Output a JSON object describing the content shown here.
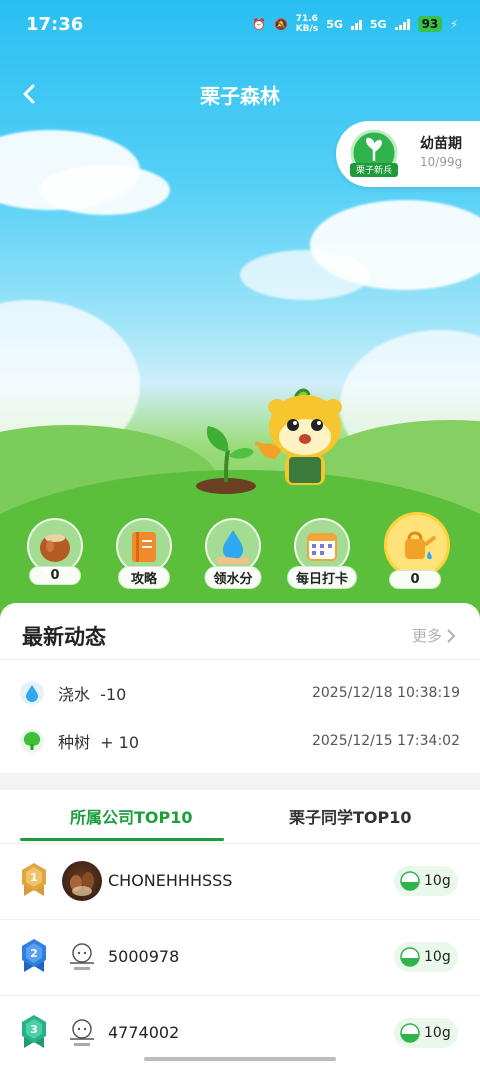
{
  "status_bar": {
    "time": "17:36",
    "speed_value": "71.6",
    "speed_unit": "KB/s",
    "net1": "5G",
    "net2": "5G",
    "battery": "93"
  },
  "nav": {
    "title": "栗子森林"
  },
  "level": {
    "badge_text": "栗子新兵",
    "stage": "幼苗期",
    "progress": "10/99g"
  },
  "actions": [
    {
      "label": "0",
      "icon": "chestnut-icon"
    },
    {
      "label": "攻略",
      "icon": "book-icon"
    },
    {
      "label": "领水分",
      "icon": "water-drop-hand-icon"
    },
    {
      "label": "每日打卡",
      "icon": "calendar-icon"
    },
    {
      "label": "0",
      "icon": "watering-can-icon"
    }
  ],
  "news": {
    "title": "最新动态",
    "more": "更多",
    "items": [
      {
        "icon": "water-drop-icon",
        "text": "浇水  -10",
        "time": "2025/12/18 10:38:19"
      },
      {
        "icon": "tree-icon",
        "text": "种树  + 10",
        "time": "2025/12/15 17:34:02"
      }
    ]
  },
  "ranking": {
    "tabs": [
      "所属公司TOP10",
      "栗子同学TOP10"
    ],
    "rows": [
      {
        "rank": "1",
        "name": "CHONEHHHSSS",
        "score": "10g"
      },
      {
        "rank": "2",
        "name": "5000978",
        "score": "10g"
      },
      {
        "rank": "3",
        "name": "4774002",
        "score": "10g"
      }
    ]
  },
  "colors": {
    "accent": "#1d9e3d",
    "gold": "#e0a440",
    "blue": "#2f7fe0",
    "teal": "#27b18a"
  }
}
